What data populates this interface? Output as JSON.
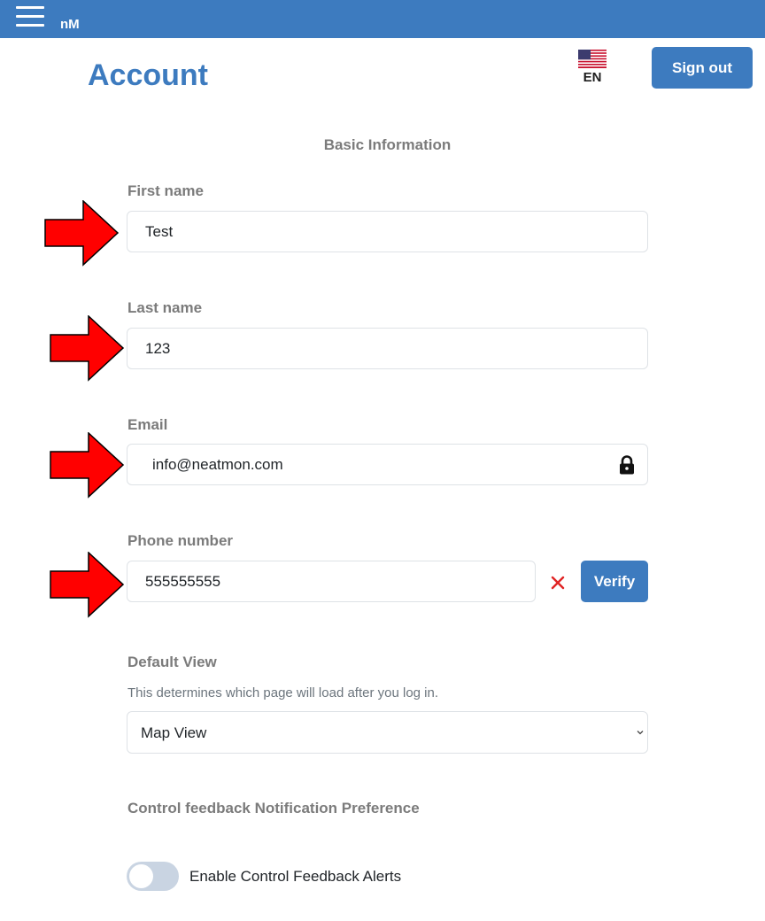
{
  "topbar": {
    "brand": "nM",
    "menu_icon": "hamburger-menu-icon"
  },
  "header": {
    "title": "Account",
    "language": "EN",
    "flag_icon": "us-flag-icon",
    "signout_label": "Sign out"
  },
  "form": {
    "section_title": "Basic Information",
    "first_name": {
      "label": "First name",
      "value": "Test"
    },
    "last_name": {
      "label": "Last name",
      "value": "123"
    },
    "email": {
      "label": "Email",
      "value": "info@neatmon.com",
      "icon": "lock-icon"
    },
    "phone": {
      "label": "Phone number",
      "value": "555555555",
      "clear_icon": "close-icon",
      "verify_label": "Verify"
    },
    "default_view": {
      "label": "Default View",
      "help": "This determines which page will load after you log in.",
      "selected": "Map View"
    },
    "notification": {
      "label": "Control feedback Notification Preference",
      "toggle_label": "Enable Control Feedback Alerts",
      "enabled": false
    }
  },
  "annotations": {
    "arrow_color": "#ff0000",
    "arrow_icon": "red-arrow-icon"
  },
  "colors": {
    "primary": "#3d7bbf",
    "label": "#7b7b7b",
    "error": "#e02424"
  }
}
